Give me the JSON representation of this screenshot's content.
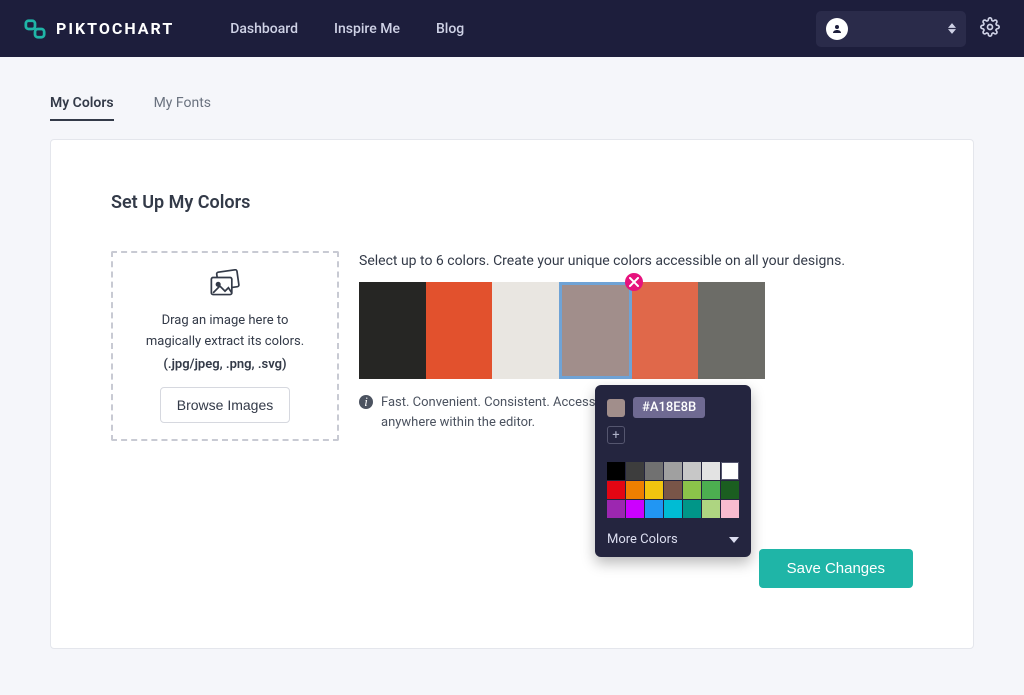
{
  "brand": "PIKTOCHART",
  "nav": {
    "dashboard": "Dashboard",
    "inspire": "Inspire Me",
    "blog": "Blog"
  },
  "tabs": {
    "colors": "My Colors",
    "fonts": "My Fonts"
  },
  "section_title": "Set Up My Colors",
  "dropzone": {
    "line1": "Drag an image here to",
    "line2": "magically extract its colors.",
    "formats": "(.jpg/jpeg, .png, .svg)",
    "browse": "Browse Images"
  },
  "instruction": "Select up to 6 colors. Create your unique colors accessible on all your designs.",
  "info": "Fast. Convenient. Consistent. Access your favorite colors anywhere within the editor.",
  "palette": [
    {
      "hex": "#262624"
    },
    {
      "hex": "#e2512d"
    },
    {
      "hex": "#e9e6e1"
    },
    {
      "hex": "#A18E8B",
      "selected": true
    },
    {
      "hex": "#e0684a"
    },
    {
      "hex": "#6c6c67"
    }
  ],
  "picker": {
    "current_hex": "#A18E8B",
    "more_label": "More Colors",
    "grid_colors": [
      "#000000",
      "#3d3d3d",
      "#717171",
      "#a0a0a0",
      "#c7c7c7",
      "#e3e3e3",
      "#ffffff",
      "#e30613",
      "#ee7f00",
      "#f1c40f",
      "#795548",
      "#8bc34a",
      "#4caf50",
      "#1b5e20",
      "#9c27b0",
      "#cc00ff",
      "#2196f3",
      "#00bcd4",
      "#009688",
      "#aed581",
      "#f8bbd0"
    ]
  },
  "save_label": "Save Changes"
}
